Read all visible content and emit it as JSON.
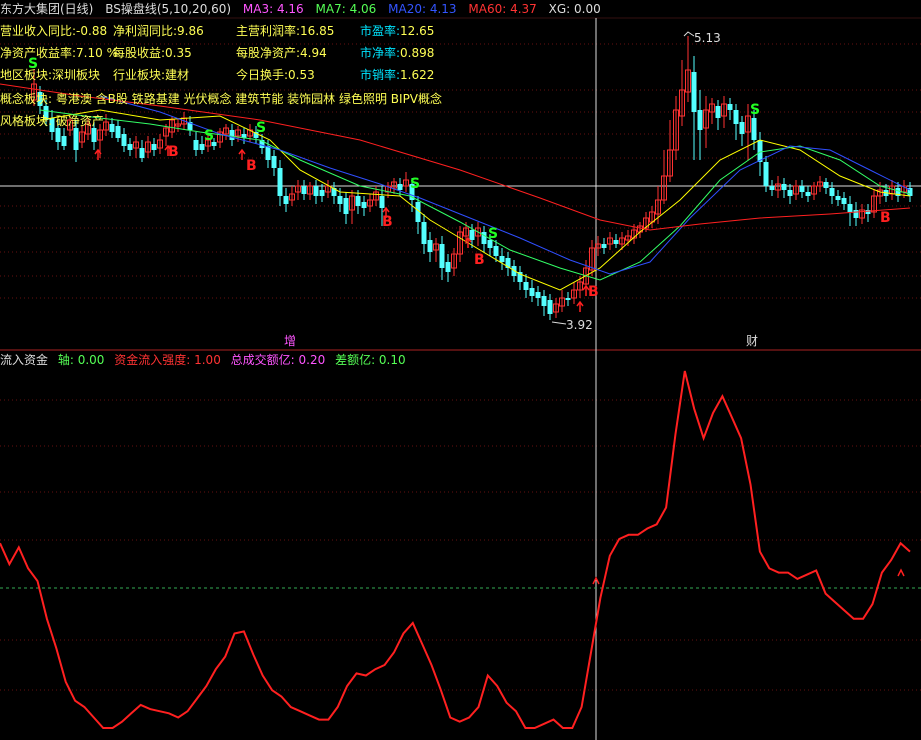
{
  "header": {
    "stock_name": "东方大集团(日线)",
    "indicator": "BS操盘线(5,10,20,60)",
    "ma3": "MA3: 4.16",
    "ma7": "MA7: 4.06",
    "ma20": "MA20: 4.13",
    "ma60": "MA60: 4.37",
    "xg": "XG: 0.00"
  },
  "fundamentals": {
    "row1": [
      {
        "label": "营业收入同比:",
        "value": "-0.88"
      },
      {
        "label": "净利润同比:",
        "value": "9.86"
      },
      {
        "label": "主营利润率:",
        "value": "16.85"
      },
      {
        "label": "市盈率:",
        "value": "12.65"
      }
    ],
    "row2": [
      {
        "label": "净资产收益率:",
        "value": "7.10 %"
      },
      {
        "label": "每股收益:",
        "value": "0.35"
      },
      {
        "label": "每股净资产:",
        "value": "4.94"
      },
      {
        "label": "市净率:",
        "value": "0.898"
      }
    ],
    "row3": [
      {
        "label": "地区板块:",
        "value": "深圳板块"
      },
      {
        "label": "行业板块:",
        "value": "建材"
      },
      {
        "label": "今日换手:",
        "value": "0.53"
      },
      {
        "label": "市销率:",
        "value": "1.622"
      }
    ],
    "concept": "概念板块: 粤港澳 含B股 铁路基建 光伏概念 建筑节能 装饰园林 绿色照明 BIPV概念",
    "style": "风格板块: 破净资产"
  },
  "price_annotations": {
    "high": "5.13",
    "low": "3.92",
    "marker_zeng": "增",
    "marker_cai": "财"
  },
  "lower_header": {
    "name": "流入资金",
    "axis": "轴: 0.00",
    "strength": "资金流入强度: 1.00",
    "total": "总成交额亿: 0.20",
    "diff": "差额亿: 0.10"
  },
  "colors": {
    "up": "#ff3232",
    "down": "#54ffff",
    "ma3": "#ffffff",
    "ma7": "#ffff00",
    "ma20": "#2f4fff",
    "ma60": "#ff2020",
    "buy": "#ff2020",
    "sell": "#22ff22",
    "flow": "#ff2020"
  },
  "chart_data": {
    "type": "line",
    "series": [
      {
        "name": "流入资金",
        "values": [
          0.88,
          0.78,
          0.86,
          0.76,
          0.7,
          0.52,
          0.38,
          0.22,
          0.13,
          0.1,
          0.05,
          0.0,
          0.0,
          0.03,
          0.07,
          0.11,
          0.09,
          0.08,
          0.07,
          0.05,
          0.08,
          0.14,
          0.2,
          0.28,
          0.34,
          0.45,
          0.46,
          0.35,
          0.25,
          0.18,
          0.15,
          0.1,
          0.08,
          0.06,
          0.04,
          0.04,
          0.1,
          0.2,
          0.26,
          0.25,
          0.28,
          0.3,
          0.36,
          0.45,
          0.5,
          0.4,
          0.3,
          0.18,
          0.05,
          0.03,
          0.05,
          0.1,
          0.25,
          0.2,
          0.12,
          0.08,
          0.0,
          0.0,
          0.02,
          0.04,
          0.0,
          0.0,
          0.1,
          0.36,
          0.62,
          0.82,
          0.9,
          0.92,
          0.92,
          0.95,
          0.97,
          1.05,
          1.4,
          1.7,
          1.52,
          1.38,
          1.5,
          1.58,
          1.48,
          1.38,
          1.16,
          0.84,
          0.76,
          0.74,
          0.74,
          0.71,
          0.73,
          0.75,
          0.64,
          0.6,
          0.56,
          0.52,
          0.52,
          0.59,
          0.74,
          0.8,
          0.88,
          0.84
        ]
      }
    ]
  }
}
